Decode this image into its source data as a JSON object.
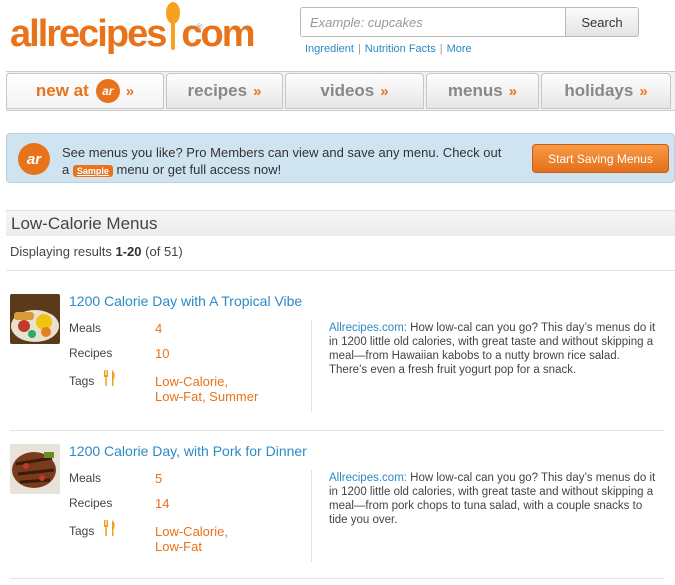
{
  "header": {
    "logo_text_left": "allrecipes",
    "logo_text_right": "com",
    "logo_reg": "®",
    "search_placeholder": "Example: cupcakes",
    "search_button": "Search",
    "links": [
      "Ingredient",
      "Nutrition Facts",
      "More"
    ],
    "link_separator": "|"
  },
  "nav": {
    "tabs": [
      {
        "label": "new at",
        "badge": "ar",
        "arrow": "»"
      },
      {
        "label": "recipes",
        "arrow": "»"
      },
      {
        "label": "videos",
        "arrow": "»"
      },
      {
        "label": "menus",
        "arrow": "»"
      },
      {
        "label": "holidays",
        "arrow": "»"
      }
    ]
  },
  "promo": {
    "logo": "ar",
    "line1": "See menus you like? Pro Members can view and save any menu. Check out",
    "line2_pre": "a",
    "sample_badge": "Sample",
    "line2_post": "menu or get full access now!",
    "button": "Start Saving Menus"
  },
  "section": {
    "title": "Low-Calorie Menus",
    "results_prefix": "Displaying results",
    "results_range": "1-20",
    "results_total": "(of 51)"
  },
  "menus": [
    {
      "title": "1200 Calorie Day with A Tropical Vibe",
      "meals_label": "Meals",
      "meals": "4",
      "recipes_label": "Recipes",
      "recipes": "10",
      "tags_label": "Tags",
      "tags_line1": "Low-Calorie,",
      "tags_line2": "Low-Fat, Summer",
      "source": "Allrecipes.com:",
      "description": "How low-cal can you go? This day’s menus do it in 1200 little old calories, with great taste and without skipping a meal—from Hawaiian kabobs to a nutty brown rice salad. There’s even a fresh fruit yogurt pop for a snack."
    },
    {
      "title": "1200 Calorie Day, with Pork for Dinner",
      "meals_label": "Meals",
      "meals": "5",
      "recipes_label": "Recipes",
      "recipes": "14",
      "tags_label": "Tags",
      "tags_line1": "Low-Calorie,",
      "tags_line2": "Low-Fat",
      "source": "Allrecipes.com:",
      "description": "How low-cal can you go? This day’s menus do it in 1200 little old calories, with great taste and without skipping a meal—from pork chops to tuna salad, with a couple snacks to tide you over."
    }
  ],
  "colors": {
    "brand_orange": "#e8731b",
    "link_blue": "#2b8ac6",
    "promo_bg": "#cfe3f0"
  }
}
